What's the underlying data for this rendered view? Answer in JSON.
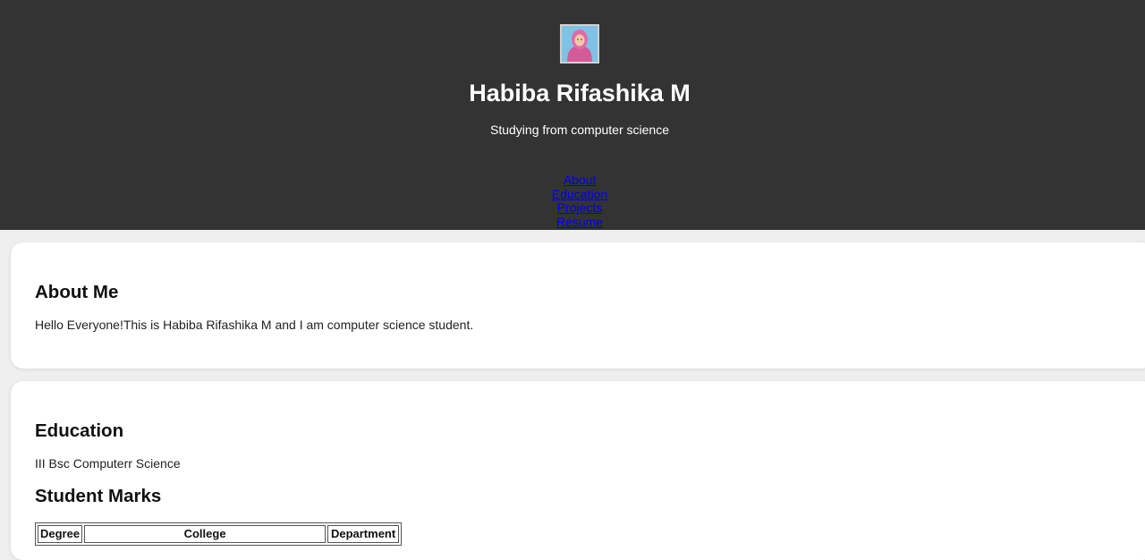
{
  "header": {
    "name": "Habiba Rifashika M",
    "tagline": "Studying from computer science",
    "background_color": "#333333",
    "avatar_icon": "profile-photo"
  },
  "nav": {
    "links": [
      {
        "label": "About"
      },
      {
        "label": "Education"
      },
      {
        "label": "Projects"
      },
      {
        "label": "Resume"
      }
    ],
    "link_color": "#0000ee"
  },
  "about": {
    "title": "About Me",
    "text": "Hello Everyone!This is Habiba Rifashika M and I am computer science student."
  },
  "education": {
    "title": "Education",
    "text": "III Bsc Computerr Science",
    "marks_title": "Student Marks",
    "table_headers": [
      "Degree",
      "College",
      "Department"
    ]
  }
}
